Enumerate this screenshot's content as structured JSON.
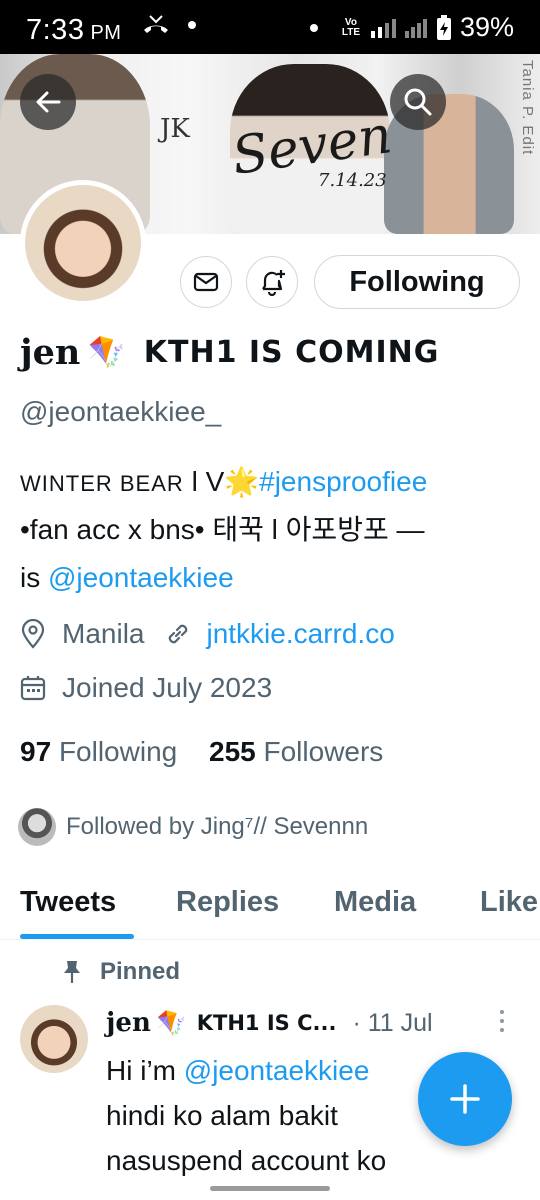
{
  "status_bar": {
    "time": "7:33",
    "ampm": "PM",
    "volte": "Vo LTE",
    "battery": "39%"
  },
  "banner": {
    "title": "Seven",
    "initials": "JK",
    "date": "7.14.23",
    "credit": "Tania P. Edit"
  },
  "profile": {
    "display_name": "jen",
    "display_name_emoji": "🪁",
    "display_name_suffix": "KTH1 IS COMING",
    "handle": "@jeontaekkiee_",
    "follow_state": "Following",
    "bio": {
      "line1_caps": "WINTER BEAR",
      "line1_mid": " l V",
      "line1_emoji": "🌟",
      "line1_hashtag": "#jensproofiee",
      "line2": "•fan acc x bns• 태꾹 l 아포방포 —",
      "line3_prefix": "is ",
      "line3_mention": "@jeontaekkiee"
    },
    "location": "Manila",
    "website": "jntkkie.carrd.co",
    "joined": "Joined July 2023",
    "following_count": "97",
    "following_label": "Following",
    "followers_count": "255",
    "followers_label": "Followers",
    "followed_by": "Followed by Jing⁷// Sevennn"
  },
  "tabs": [
    "Tweets",
    "Replies",
    "Media",
    "Like"
  ],
  "pinned_label": "Pinned",
  "tweet": {
    "name": "jen",
    "emoji": "🪁",
    "suffix": "KTH1 IS C...",
    "date": "· 11 Jul",
    "line1_prefix": "Hi i’m ",
    "line1_mention": "@jeontaekkiee",
    "line2": "hindi ko alam bakit",
    "line3": "nasuspend account ko"
  },
  "colors": {
    "accent": "#1d9bf0",
    "text": "#0f1419",
    "secondary": "#536471"
  }
}
